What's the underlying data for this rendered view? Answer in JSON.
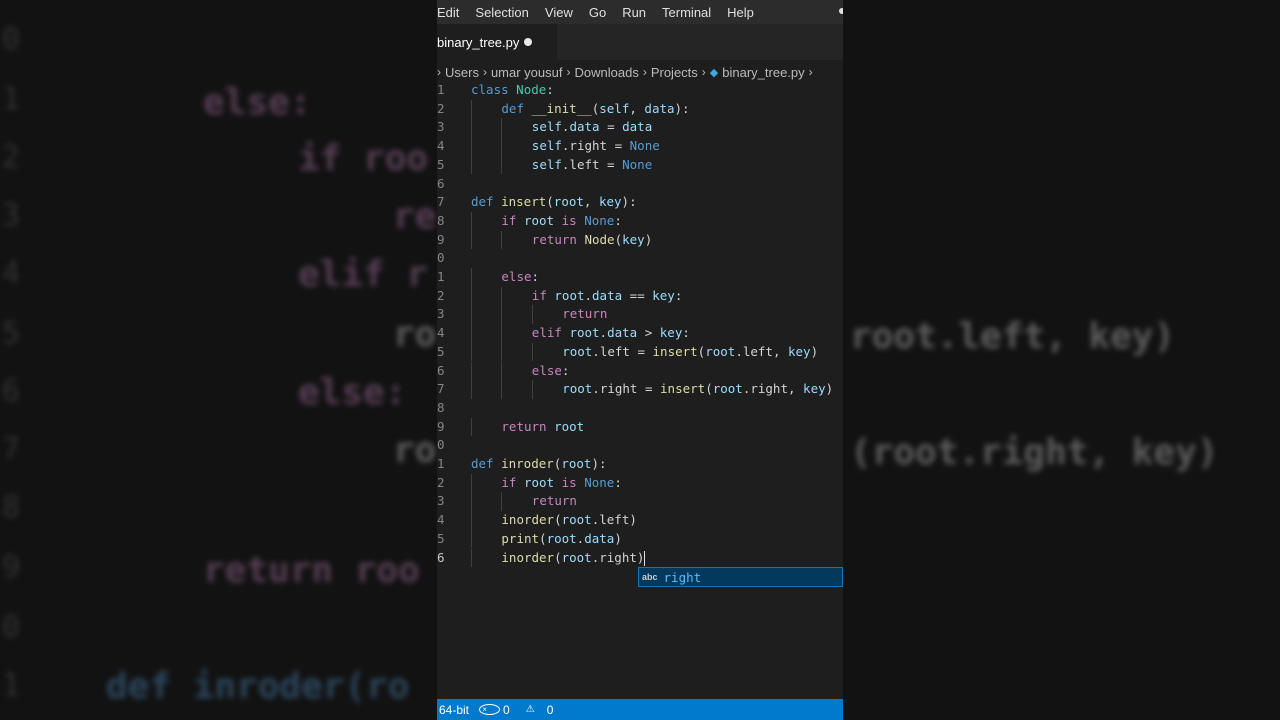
{
  "menu": [
    "Edit",
    "Selection",
    "View",
    "Go",
    "Run",
    "Terminal",
    "Help"
  ],
  "tab": {
    "filename": "binary_tree.py"
  },
  "breadcrumb": {
    "items": [
      "Users",
      "umar yousuf",
      "Downloads",
      "Projects",
      "binary_tree.py"
    ]
  },
  "code": {
    "lines": [
      {
        "n": "1",
        "text": "class Node:"
      },
      {
        "n": "2",
        "text": "def __init__(self, data):"
      },
      {
        "n": "3",
        "text": "self.data = data"
      },
      {
        "n": "4",
        "text": "self.right = None"
      },
      {
        "n": "5",
        "text": "self.left = None"
      },
      {
        "n": "6",
        "text": ""
      },
      {
        "n": "7",
        "text": "def insert(root, key):"
      },
      {
        "n": "8",
        "text": "if root is None:"
      },
      {
        "n": "9",
        "text": "return Node(key)"
      },
      {
        "n": "0",
        "text": ""
      },
      {
        "n": "1",
        "text": "else:"
      },
      {
        "n": "2",
        "text": "if root.data == key:"
      },
      {
        "n": "3",
        "text": "return"
      },
      {
        "n": "4",
        "text": "elif root.data > key:"
      },
      {
        "n": "5",
        "text": "root.left = insert(root.left, key)"
      },
      {
        "n": "6",
        "text": "else:"
      },
      {
        "n": "7",
        "text": "root.right = insert(root.right, key)"
      },
      {
        "n": "8",
        "text": ""
      },
      {
        "n": "9",
        "text": "return root"
      },
      {
        "n": "0",
        "text": ""
      },
      {
        "n": "1",
        "text": "def inroder(root):"
      },
      {
        "n": "2",
        "text": "if root is None:"
      },
      {
        "n": "3",
        "text": "return"
      },
      {
        "n": "4",
        "text": "inorder(root.left)"
      },
      {
        "n": "5",
        "text": "print(root.data)"
      },
      {
        "n": "6",
        "text": "inorder(root.right)"
      }
    ]
  },
  "suggestion": {
    "kind": "abc",
    "word": "right"
  },
  "status": {
    "bitness": "64-bit",
    "errors": "0",
    "warnings": "0"
  },
  "background": {
    "line_numbers": [
      "0",
      "1",
      "2",
      "3",
      "4",
      "5",
      "6",
      "7",
      "8",
      "9",
      "0",
      "1"
    ],
    "left_code": [
      "else:",
      "if roo",
      "re",
      "elif r",
      "ro",
      "else:",
      "ro",
      "return roo",
      "def inroder(ro"
    ],
    "right_code": [
      "root.left, key)",
      "(root.right, key)"
    ]
  },
  "colors": {
    "status_bar": "#007acc",
    "editor_bg": "#1e1e1e",
    "keyword": "#569cd6",
    "function": "#dcdcaa"
  }
}
